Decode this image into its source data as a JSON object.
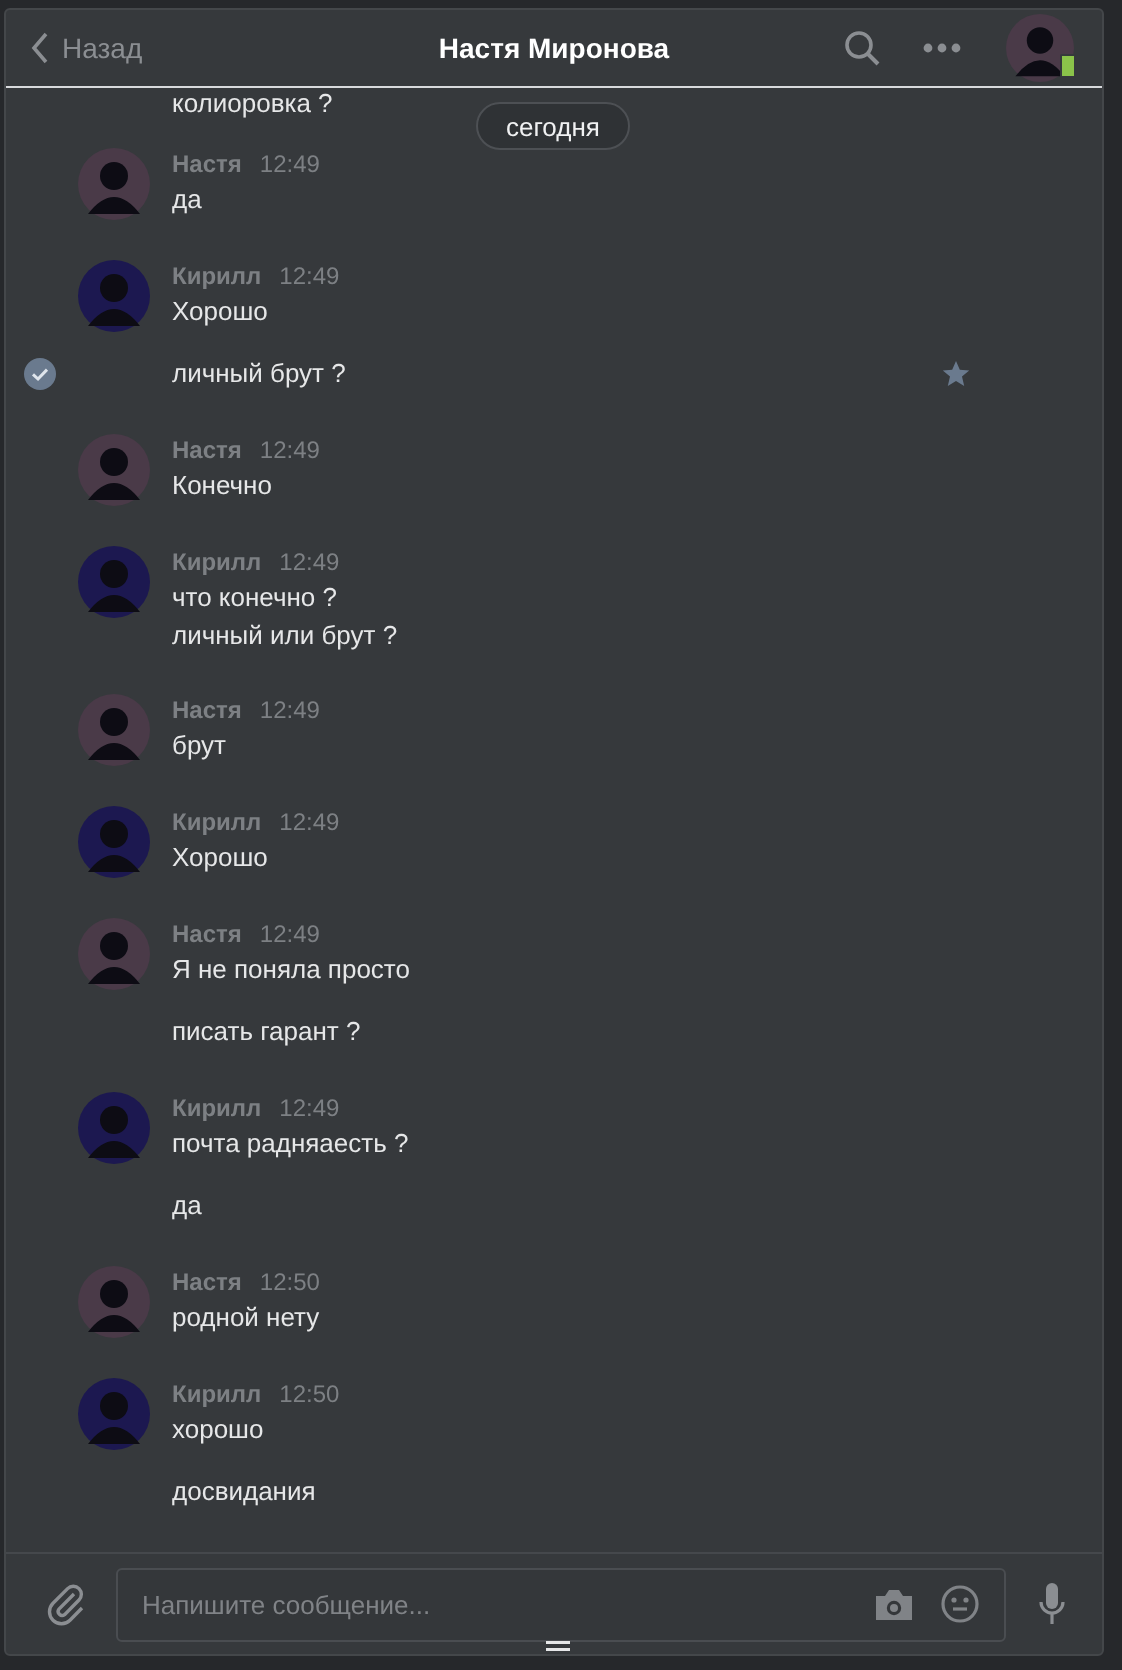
{
  "header": {
    "back": "Назад",
    "title": "Настя Миронова",
    "avatar": {
      "color": "#4a3a48",
      "online_mobile": true
    }
  },
  "cut_message": "колиоровка ?",
  "date_pill": "сегодня",
  "groups": [
    {
      "author": "Настя",
      "time": "12:49",
      "color": "#4a3a48",
      "messages": [
        {
          "lines": [
            "да"
          ],
          "selected": false
        }
      ]
    },
    {
      "author": "Кирилл",
      "time": "12:49",
      "color": "#1c1850",
      "messages": [
        {
          "lines": [
            "Хорошо"
          ],
          "selected": false
        },
        {
          "lines": [
            "личный брут ?"
          ],
          "selected": true
        }
      ]
    },
    {
      "author": "Настя",
      "time": "12:49",
      "color": "#4a3a48",
      "messages": [
        {
          "lines": [
            "Конечно"
          ],
          "selected": false
        }
      ]
    },
    {
      "author": "Кирилл",
      "time": "12:49",
      "color": "#1c1850",
      "messages": [
        {
          "lines": [
            "что конечно ?",
            "личный или брут ?"
          ],
          "selected": false
        }
      ]
    },
    {
      "author": "Настя",
      "time": "12:49",
      "color": "#4a3a48",
      "messages": [
        {
          "lines": [
            "брут"
          ],
          "selected": false
        }
      ]
    },
    {
      "author": "Кирилл",
      "time": "12:49",
      "color": "#1c1850",
      "messages": [
        {
          "lines": [
            "Хорошо"
          ],
          "selected": false
        }
      ]
    },
    {
      "author": "Настя",
      "time": "12:49",
      "color": "#4a3a48",
      "messages": [
        {
          "lines": [
            "Я не поняла просто"
          ],
          "selected": false
        },
        {
          "lines": [
            "писать гарант ?"
          ],
          "selected": false
        }
      ]
    },
    {
      "author": "Кирилл",
      "time": "12:49",
      "color": "#1c1850",
      "messages": [
        {
          "lines": [
            "почта радняаесть ?"
          ],
          "selected": false
        },
        {
          "lines": [
            "да"
          ],
          "selected": false
        }
      ]
    },
    {
      "author": "Настя",
      "time": "12:50",
      "color": "#4a3a48",
      "messages": [
        {
          "lines": [
            "родной нету"
          ],
          "selected": false
        }
      ]
    },
    {
      "author": "Кирилл",
      "time": "12:50",
      "color": "#1c1850",
      "messages": [
        {
          "lines": [
            "хорошо"
          ],
          "selected": false
        },
        {
          "lines": [
            "досвидания"
          ],
          "selected": false
        }
      ]
    }
  ],
  "composer": {
    "placeholder": "Напишите сообщение..."
  }
}
